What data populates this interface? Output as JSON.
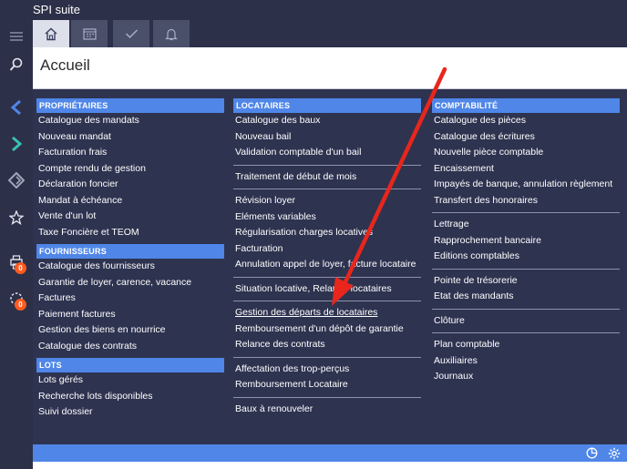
{
  "app": {
    "title": "SPI suite"
  },
  "page": {
    "title": "Accueil"
  },
  "rail": {
    "badge_a": "0",
    "badge_b": "0"
  },
  "columns": {
    "proprietaires": {
      "header": "PROPRIÉTAIRES",
      "items": [
        "Catalogue des mandats",
        "Nouveau mandat",
        "Facturation frais",
        "Compte rendu de gestion",
        "Déclaration foncier",
        "Mandat à échéance",
        "Vente d'un lot",
        "Taxe Foncière et TEOM"
      ]
    },
    "fournisseurs": {
      "header": "FOURNISSEURS",
      "items": [
        "Catalogue des fournisseurs",
        "Garantie de loyer, carence, vacance",
        "Factures",
        "Paiement factures",
        "Gestion des biens en nourrice",
        "Catalogue des contrats"
      ]
    },
    "lots": {
      "header": "LOTS",
      "items": [
        "Lots gérés",
        "Recherche lots disponibles",
        "Suivi dossier"
      ]
    },
    "locataires": {
      "header": "LOCATAIRES",
      "group1": [
        "Catalogue des baux",
        "Nouveau bail",
        "Validation comptable d'un bail"
      ],
      "group2": [
        "Traitement de début de mois"
      ],
      "group3": [
        "Révision loyer",
        "Eléments variables",
        "Régularisation charges locatives",
        "Facturation",
        "Annulation appel de loyer, facture locataire"
      ],
      "group4": [
        "Situation locative, Relance locataires"
      ],
      "group5": [
        "Gestion des départs de locataires",
        "Remboursement d'un dépôt de garantie",
        "Relance des contrats"
      ],
      "group6": [
        "Affectation des trop-perçus",
        "Remboursement Locataire"
      ],
      "group7": [
        "Baux à renouveler"
      ]
    },
    "comptabilite": {
      "header": "COMPTABILITÉ",
      "group1": [
        "Catalogue des pièces",
        "Catalogue des écritures",
        "Nouvelle pièce comptable",
        "Encaissement",
        "Impayés de banque, annulation règlement",
        "Transfert des honoraires"
      ],
      "group2": [
        "Lettrage",
        "Rapprochement bancaire",
        "Editions comptables"
      ],
      "group3": [
        "Pointe de trésorerie",
        "Etat des mandants"
      ],
      "group4": [
        "Clôture"
      ],
      "group5": [
        "Plan comptable",
        "Auxiliaires",
        "Journaux"
      ]
    }
  },
  "colors": {
    "rail": "#2c3048",
    "menu_bg": "#2e3350",
    "accent": "#4f86e8",
    "arrow": "#e8261c",
    "badge": "#ff5a1f"
  }
}
